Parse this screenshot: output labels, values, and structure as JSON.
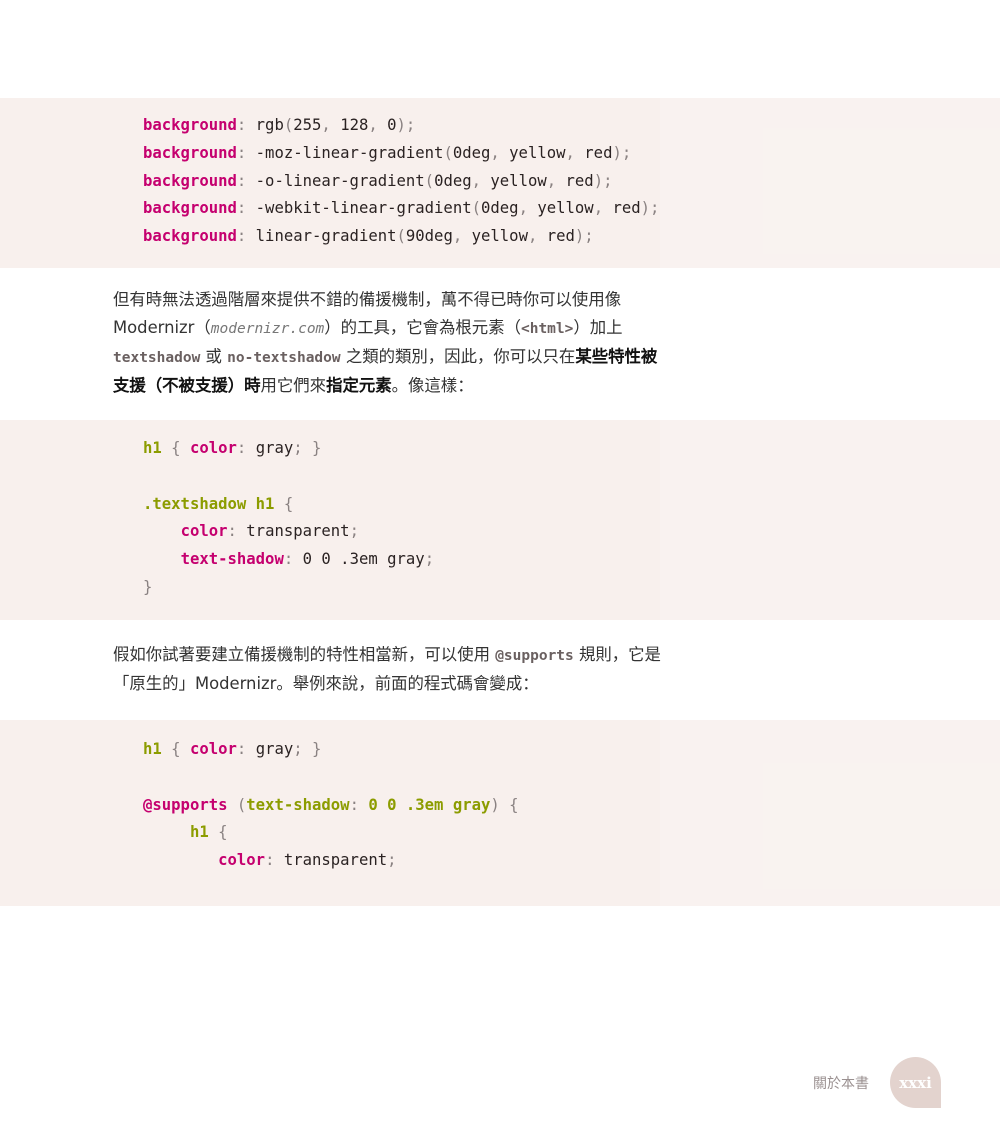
{
  "code_blocks": [
    {
      "lines": [
        [
          {
            "t": "background",
            "k": "p"
          },
          {
            "t": ": ",
            "k": "x"
          },
          {
            "t": "rgb",
            "k": "v"
          },
          {
            "t": "(",
            "k": "x"
          },
          {
            "t": "255",
            "k": "v"
          },
          {
            "t": ", ",
            "k": "x"
          },
          {
            "t": "128",
            "k": "v"
          },
          {
            "t": ", ",
            "k": "x"
          },
          {
            "t": "0",
            "k": "v"
          },
          {
            "t": ");",
            "k": "x"
          }
        ],
        [
          {
            "t": "background",
            "k": "p"
          },
          {
            "t": ": ",
            "k": "x"
          },
          {
            "t": "-moz-linear-gradient",
            "k": "v"
          },
          {
            "t": "(",
            "k": "x"
          },
          {
            "t": "0deg",
            "k": "v"
          },
          {
            "t": ", ",
            "k": "x"
          },
          {
            "t": "yellow",
            "k": "v"
          },
          {
            "t": ", ",
            "k": "x"
          },
          {
            "t": "red",
            "k": "v"
          },
          {
            "t": ");",
            "k": "x"
          }
        ],
        [
          {
            "t": "background",
            "k": "p"
          },
          {
            "t": ": ",
            "k": "x"
          },
          {
            "t": "-o-linear-gradient",
            "k": "v"
          },
          {
            "t": "(",
            "k": "x"
          },
          {
            "t": "0deg",
            "k": "v"
          },
          {
            "t": ", ",
            "k": "x"
          },
          {
            "t": "yellow",
            "k": "v"
          },
          {
            "t": ", ",
            "k": "x"
          },
          {
            "t": "red",
            "k": "v"
          },
          {
            "t": ");",
            "k": "x"
          }
        ],
        [
          {
            "t": "background",
            "k": "p"
          },
          {
            "t": ": ",
            "k": "x"
          },
          {
            "t": "-webkit-linear-gradient",
            "k": "v"
          },
          {
            "t": "(",
            "k": "x"
          },
          {
            "t": "0deg",
            "k": "v"
          },
          {
            "t": ", ",
            "k": "x"
          },
          {
            "t": "yellow",
            "k": "v"
          },
          {
            "t": ", ",
            "k": "x"
          },
          {
            "t": "red",
            "k": "v"
          },
          {
            "t": ");",
            "k": "x"
          }
        ],
        [
          {
            "t": "background",
            "k": "p"
          },
          {
            "t": ": ",
            "k": "x"
          },
          {
            "t": "linear-gradient",
            "k": "v"
          },
          {
            "t": "(",
            "k": "x"
          },
          {
            "t": "90deg",
            "k": "v"
          },
          {
            "t": ", ",
            "k": "x"
          },
          {
            "t": "yellow",
            "k": "v"
          },
          {
            "t": ", ",
            "k": "x"
          },
          {
            "t": "red",
            "k": "v"
          },
          {
            "t": ");",
            "k": "x"
          }
        ]
      ]
    },
    {
      "lines": [
        [
          {
            "t": "h1",
            "k": "s"
          },
          {
            "t": " { ",
            "k": "x"
          },
          {
            "t": "color",
            "k": "p"
          },
          {
            "t": ": ",
            "k": "x"
          },
          {
            "t": "gray",
            "k": "v"
          },
          {
            "t": "; }",
            "k": "x"
          }
        ],
        [],
        [
          {
            "t": ".textshadow h1",
            "k": "s"
          },
          {
            "t": " {",
            "k": "x"
          }
        ],
        [
          {
            "t": "    ",
            "k": "v"
          },
          {
            "t": "color",
            "k": "p"
          },
          {
            "t": ": ",
            "k": "x"
          },
          {
            "t": "transparent",
            "k": "v"
          },
          {
            "t": ";",
            "k": "x"
          }
        ],
        [
          {
            "t": "    ",
            "k": "v"
          },
          {
            "t": "text-shadow",
            "k": "p"
          },
          {
            "t": ": ",
            "k": "x"
          },
          {
            "t": "0 0 .3em gray",
            "k": "v"
          },
          {
            "t": ";",
            "k": "x"
          }
        ],
        [
          {
            "t": "}",
            "k": "x"
          }
        ]
      ]
    },
    {
      "lines": [
        [
          {
            "t": "h1",
            "k": "s"
          },
          {
            "t": " { ",
            "k": "x"
          },
          {
            "t": "color",
            "k": "p"
          },
          {
            "t": ": ",
            "k": "x"
          },
          {
            "t": "gray",
            "k": "v"
          },
          {
            "t": "; }",
            "k": "x"
          }
        ],
        [],
        [
          {
            "t": "@supports",
            "k": "p"
          },
          {
            "t": " (",
            "k": "x"
          },
          {
            "t": "text-shadow",
            "k": "s"
          },
          {
            "t": ": ",
            "k": "x"
          },
          {
            "t": "0 0 .3em gray",
            "k": "s"
          },
          {
            "t": ") {",
            "k": "x"
          }
        ],
        [
          {
            "t": "     ",
            "k": "v"
          },
          {
            "t": "h1",
            "k": "s"
          },
          {
            "t": " {",
            "k": "x"
          }
        ],
        [
          {
            "t": "        ",
            "k": "v"
          },
          {
            "t": "color",
            "k": "p"
          },
          {
            "t": ": ",
            "k": "x"
          },
          {
            "t": "transparent",
            "k": "v"
          },
          {
            "t": ";",
            "k": "x"
          }
        ]
      ]
    }
  ],
  "paragraphs": [
    [
      {
        "t": "但有時無法透過階層來提供不錯的備援機制，萬不得已時你可以使用像 Modernizr（",
        "k": ""
      },
      {
        "t": "modernizr.com",
        "k": "i"
      },
      {
        "t": "）的工具，它會為根元素（",
        "k": ""
      },
      {
        "t": "<html>",
        "k": "c"
      },
      {
        "t": "）加上 ",
        "k": ""
      },
      {
        "t": "textshadow",
        "k": "c"
      },
      {
        "t": " 或 ",
        "k": ""
      },
      {
        "t": "no-textshadow",
        "k": "c"
      },
      {
        "t": " 之類的類別，因此，你可以只在",
        "k": ""
      },
      {
        "t": "某些特性被支援（不被支援）時",
        "k": "b"
      },
      {
        "t": "用它們來",
        "k": ""
      },
      {
        "t": "指定元素",
        "k": "b"
      },
      {
        "t": "。像這樣：",
        "k": ""
      }
    ],
    [
      {
        "t": "假如你試著要建立備援機制的特性相當新，可以使用 ",
        "k": ""
      },
      {
        "t": "@supports",
        "k": "c"
      },
      {
        "t": " 規則，它是「原生的」Modernizr。舉例來說，前面的程式碼會變成：",
        "k": ""
      }
    ]
  ],
  "footer": {
    "section_title": "關於本書",
    "page_number": "xxxi"
  },
  "colors": {
    "property": "#c5006f",
    "selector": "#8c9c00",
    "punctuation": "#8a8282",
    "code_background": "#f8f0ed",
    "page_badge": "#e3d3ce"
  }
}
